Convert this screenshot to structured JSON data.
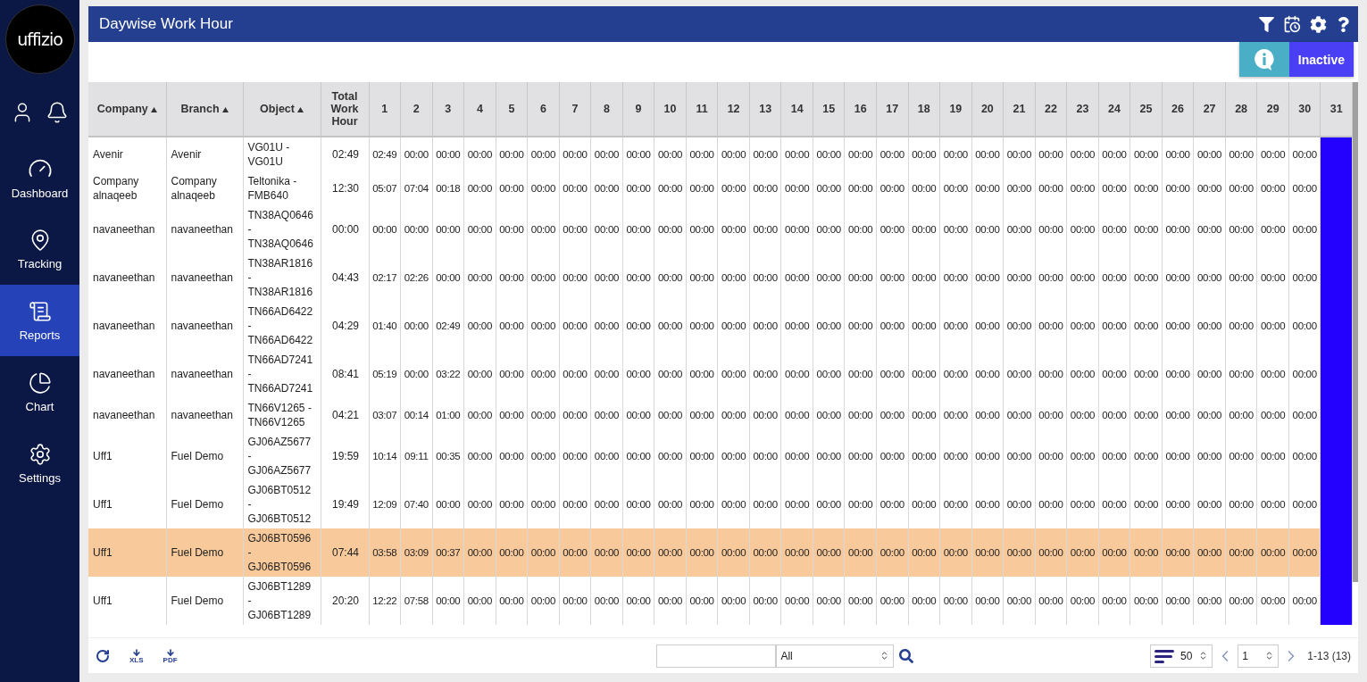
{
  "sidebar": {
    "logo": "uffizio",
    "items": [
      {
        "label": "Dashboard",
        "kind": "dashboard",
        "selected": false
      },
      {
        "label": "Tracking",
        "kind": "tracking",
        "selected": false
      },
      {
        "label": "Reports",
        "kind": "reports",
        "selected": true
      },
      {
        "label": "Chart",
        "kind": "chart",
        "selected": false
      },
      {
        "label": "Settings",
        "kind": "settings",
        "selected": false
      }
    ]
  },
  "window": {
    "title": "Daywise Work Hour"
  },
  "status_badge": {
    "label": "Inactive"
  },
  "table": {
    "columns": [
      {
        "label": "Company",
        "sortable": true
      },
      {
        "label": "Branch",
        "sortable": true
      },
      {
        "label": "Object",
        "sortable": true
      },
      {
        "label": "Total Work Hour",
        "sortable": false
      }
    ],
    "day_columns": [
      {
        "label": "1",
        "highlighted": false
      },
      {
        "label": "2",
        "highlighted": false
      },
      {
        "label": "3",
        "highlighted": false
      },
      {
        "label": "4",
        "highlighted": false
      },
      {
        "label": "5",
        "highlighted": false
      },
      {
        "label": "6",
        "highlighted": false
      },
      {
        "label": "7",
        "highlighted": false
      },
      {
        "label": "8",
        "highlighted": false
      },
      {
        "label": "9",
        "highlighted": false
      },
      {
        "label": "10",
        "highlighted": false
      },
      {
        "label": "11",
        "highlighted": false
      },
      {
        "label": "12",
        "highlighted": false
      },
      {
        "label": "13",
        "highlighted": false
      },
      {
        "label": "14",
        "highlighted": false
      },
      {
        "label": "15",
        "highlighted": false
      },
      {
        "label": "16",
        "highlighted": false
      },
      {
        "label": "17",
        "highlighted": false
      },
      {
        "label": "18",
        "highlighted": false
      },
      {
        "label": "19",
        "highlighted": false
      },
      {
        "label": "20",
        "highlighted": false
      },
      {
        "label": "21",
        "highlighted": false
      },
      {
        "label": "22",
        "highlighted": false
      },
      {
        "label": "23",
        "highlighted": false
      },
      {
        "label": "24",
        "highlighted": false
      },
      {
        "label": "25",
        "highlighted": false
      },
      {
        "label": "26",
        "highlighted": false
      },
      {
        "label": "27",
        "highlighted": false
      },
      {
        "label": "28",
        "highlighted": false
      },
      {
        "label": "29",
        "highlighted": false
      },
      {
        "label": "30",
        "highlighted": false
      },
      {
        "label": "31",
        "highlighted": true
      }
    ],
    "rows": [
      {
        "company": "Avenir",
        "branch": "Avenir",
        "object": "VG01U - VG01U",
        "total": "02:49",
        "selected": false,
        "days": [
          "02:49",
          "00:00",
          "00:00",
          "00:00",
          "00:00",
          "00:00",
          "00:00",
          "00:00",
          "00:00",
          "00:00",
          "00:00",
          "00:00",
          "00:00",
          "00:00",
          "00:00",
          "00:00",
          "00:00",
          "00:00",
          "00:00",
          "00:00",
          "00:00",
          "00:00",
          "00:00",
          "00:00",
          "00:00",
          "00:00",
          "00:00",
          "00:00",
          "00:00",
          "00:00"
        ]
      },
      {
        "company": "Company alnaqeeb",
        "branch": "Company alnaqeeb",
        "object": "Teltonika - FMB640",
        "total": "12:30",
        "selected": false,
        "days": [
          "05:07",
          "07:04",
          "00:18",
          "00:00",
          "00:00",
          "00:00",
          "00:00",
          "00:00",
          "00:00",
          "00:00",
          "00:00",
          "00:00",
          "00:00",
          "00:00",
          "00:00",
          "00:00",
          "00:00",
          "00:00",
          "00:00",
          "00:00",
          "00:00",
          "00:00",
          "00:00",
          "00:00",
          "00:00",
          "00:00",
          "00:00",
          "00:00",
          "00:00",
          "00:00"
        ]
      },
      {
        "company": "navaneethan",
        "branch": "navaneethan",
        "object": "TN38AQ0646 - TN38AQ0646",
        "total": "00:00",
        "selected": false,
        "days": [
          "00:00",
          "00:00",
          "00:00",
          "00:00",
          "00:00",
          "00:00",
          "00:00",
          "00:00",
          "00:00",
          "00:00",
          "00:00",
          "00:00",
          "00:00",
          "00:00",
          "00:00",
          "00:00",
          "00:00",
          "00:00",
          "00:00",
          "00:00",
          "00:00",
          "00:00",
          "00:00",
          "00:00",
          "00:00",
          "00:00",
          "00:00",
          "00:00",
          "00:00",
          "00:00"
        ]
      },
      {
        "company": "navaneethan",
        "branch": "navaneethan",
        "object": "TN38AR1816 - TN38AR1816",
        "total": "04:43",
        "selected": false,
        "days": [
          "02:17",
          "02:26",
          "00:00",
          "00:00",
          "00:00",
          "00:00",
          "00:00",
          "00:00",
          "00:00",
          "00:00",
          "00:00",
          "00:00",
          "00:00",
          "00:00",
          "00:00",
          "00:00",
          "00:00",
          "00:00",
          "00:00",
          "00:00",
          "00:00",
          "00:00",
          "00:00",
          "00:00",
          "00:00",
          "00:00",
          "00:00",
          "00:00",
          "00:00",
          "00:00"
        ]
      },
      {
        "company": "navaneethan",
        "branch": "navaneethan",
        "object": "TN66AD6422 - TN66AD6422",
        "total": "04:29",
        "selected": false,
        "days": [
          "01:40",
          "00:00",
          "02:49",
          "00:00",
          "00:00",
          "00:00",
          "00:00",
          "00:00",
          "00:00",
          "00:00",
          "00:00",
          "00:00",
          "00:00",
          "00:00",
          "00:00",
          "00:00",
          "00:00",
          "00:00",
          "00:00",
          "00:00",
          "00:00",
          "00:00",
          "00:00",
          "00:00",
          "00:00",
          "00:00",
          "00:00",
          "00:00",
          "00:00",
          "00:00"
        ]
      },
      {
        "company": "navaneethan",
        "branch": "navaneethan",
        "object": "TN66AD7241 - TN66AD7241",
        "total": "08:41",
        "selected": false,
        "days": [
          "05:19",
          "00:00",
          "03:22",
          "00:00",
          "00:00",
          "00:00",
          "00:00",
          "00:00",
          "00:00",
          "00:00",
          "00:00",
          "00:00",
          "00:00",
          "00:00",
          "00:00",
          "00:00",
          "00:00",
          "00:00",
          "00:00",
          "00:00",
          "00:00",
          "00:00",
          "00:00",
          "00:00",
          "00:00",
          "00:00",
          "00:00",
          "00:00",
          "00:00",
          "00:00"
        ]
      },
      {
        "company": "navaneethan",
        "branch": "navaneethan",
        "object": "TN66V1265 - TN66V1265",
        "total": "04:21",
        "selected": false,
        "days": [
          "03:07",
          "00:14",
          "01:00",
          "00:00",
          "00:00",
          "00:00",
          "00:00",
          "00:00",
          "00:00",
          "00:00",
          "00:00",
          "00:00",
          "00:00",
          "00:00",
          "00:00",
          "00:00",
          "00:00",
          "00:00",
          "00:00",
          "00:00",
          "00:00",
          "00:00",
          "00:00",
          "00:00",
          "00:00",
          "00:00",
          "00:00",
          "00:00",
          "00:00",
          "00:00"
        ]
      },
      {
        "company": "Uff1",
        "branch": "Fuel Demo",
        "object": "GJ06AZ5677 - GJ06AZ5677",
        "total": "19:59",
        "selected": false,
        "days": [
          "10:14",
          "09:11",
          "00:35",
          "00:00",
          "00:00",
          "00:00",
          "00:00",
          "00:00",
          "00:00",
          "00:00",
          "00:00",
          "00:00",
          "00:00",
          "00:00",
          "00:00",
          "00:00",
          "00:00",
          "00:00",
          "00:00",
          "00:00",
          "00:00",
          "00:00",
          "00:00",
          "00:00",
          "00:00",
          "00:00",
          "00:00",
          "00:00",
          "00:00",
          "00:00"
        ]
      },
      {
        "company": "Uff1",
        "branch": "Fuel Demo",
        "object": "GJ06BT0512 - GJ06BT0512",
        "total": "19:49",
        "selected": false,
        "days": [
          "12:09",
          "07:40",
          "00:00",
          "00:00",
          "00:00",
          "00:00",
          "00:00",
          "00:00",
          "00:00",
          "00:00",
          "00:00",
          "00:00",
          "00:00",
          "00:00",
          "00:00",
          "00:00",
          "00:00",
          "00:00",
          "00:00",
          "00:00",
          "00:00",
          "00:00",
          "00:00",
          "00:00",
          "00:00",
          "00:00",
          "00:00",
          "00:00",
          "00:00",
          "00:00"
        ]
      },
      {
        "company": "Uff1",
        "branch": "Fuel Demo",
        "object": "GJ06BT0596 - GJ06BT0596",
        "total": "07:44",
        "selected": true,
        "days": [
          "03:58",
          "03:09",
          "00:37",
          "00:00",
          "00:00",
          "00:00",
          "00:00",
          "00:00",
          "00:00",
          "00:00",
          "00:00",
          "00:00",
          "00:00",
          "00:00",
          "00:00",
          "00:00",
          "00:00",
          "00:00",
          "00:00",
          "00:00",
          "00:00",
          "00:00",
          "00:00",
          "00:00",
          "00:00",
          "00:00",
          "00:00",
          "00:00",
          "00:00",
          "00:00"
        ]
      },
      {
        "company": "Uff1",
        "branch": "Fuel Demo",
        "object": "GJ06BT1289 - GJ06BT1289",
        "total": "20:20",
        "selected": false,
        "days": [
          "12:22",
          "07:58",
          "00:00",
          "00:00",
          "00:00",
          "00:00",
          "00:00",
          "00:00",
          "00:00",
          "00:00",
          "00:00",
          "00:00",
          "00:00",
          "00:00",
          "00:00",
          "00:00",
          "00:00",
          "00:00",
          "00:00",
          "00:00",
          "00:00",
          "00:00",
          "00:00",
          "00:00",
          "00:00",
          "00:00",
          "00:00",
          "00:00",
          "00:00",
          "00:00"
        ]
      }
    ]
  },
  "footer": {
    "exports": [
      {
        "label": "XLS"
      },
      {
        "label": "PDF"
      }
    ],
    "filter_value": "All",
    "page_size": "50",
    "page": "1",
    "range": "1-13 (13)"
  }
}
